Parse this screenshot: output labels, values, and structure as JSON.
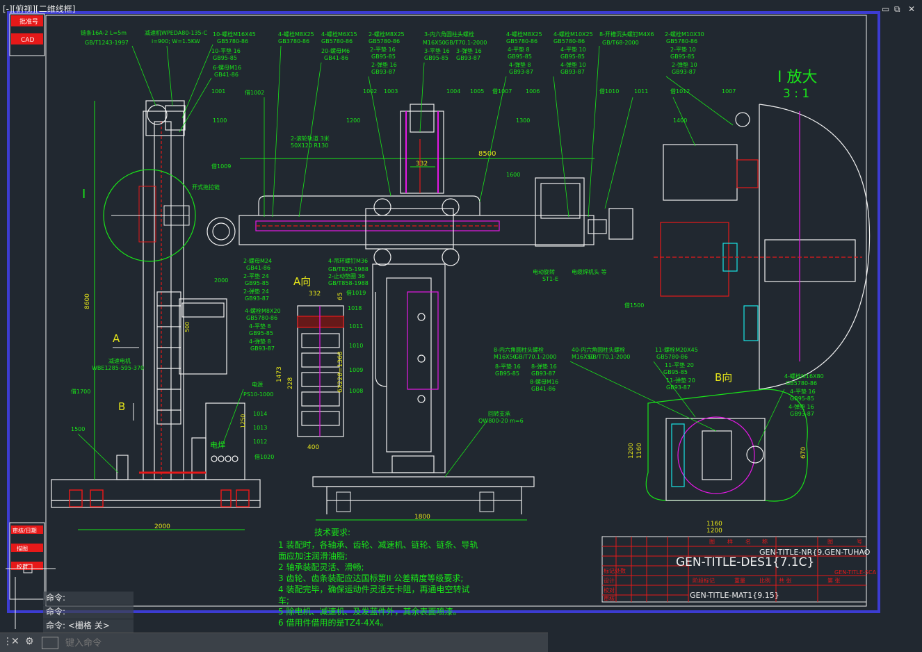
{
  "viewport_label": "[-][俯视][二维线框]",
  "window_controls": [
    "▭",
    "⧉",
    "✕"
  ],
  "side_panel_labels": [
    "批准号",
    "CAD"
  ],
  "side_panel_bottom_labels": [
    "审核/日期",
    "描图",
    "校对"
  ],
  "main_title": {
    "label": "I 放大",
    "scale": "3 : 1"
  },
  "view_labels": {
    "a_view": "A向",
    "b_view": "B向",
    "arrow_a": "A",
    "arrow_b": "B",
    "detail_i": "I"
  },
  "callouts_top": [
    "链条16A-2 L=5m",
    "GB/T1243-1997",
    "减速机WPEDA80-135-C",
    "i=900; W=1.5KW",
    "10-螺栓M16X45",
    "GB5780-86",
    "10-平垫 16",
    "GB95-85",
    "6-螺母M16",
    "GB41-86",
    "4-螺栓M8X25",
    "GB3780-86",
    "4-螺栓M6X15",
    "GB5780-86",
    "20-螺母M6",
    "GB41-86",
    "2-螺栓M8X25",
    "GB5780-86",
    "2-平垫 16",
    "GB95-85",
    "2-弹垫 16",
    "GB93-87",
    "3-内六角圆柱头螺栓",
    "M16X50",
    "GB/T70.1-2000",
    "3-平垫 16",
    "3-弹垫 16",
    "GB95-85",
    "GB93-87",
    "4-螺栓M8X25",
    "GB5780-86",
    "4-平垫 8",
    "GB95-85",
    "4-弹垫 8",
    "GB93-87",
    "4-螺栓M10X25",
    "GB5780-86",
    "4-平垫 10",
    "GB95-85",
    "4-弹垫 10",
    "GB93-87",
    "8-开槽沉头螺钉M4X6",
    "GB/T68-2000",
    "2-螺栓M10X30",
    "GB5780-86",
    "2-平垫 10",
    "GB95-85",
    "2-弹垫 10",
    "GB93-87"
  ],
  "part_numbers": [
    "1001",
    "1100",
    "借1002",
    "1002",
    "1003",
    "1004",
    "1005",
    "借1007",
    "1006",
    "借1010",
    "1011",
    "借1012",
    "1007",
    "1200",
    "1300",
    "1400",
    "1600",
    "借1009",
    "2000",
    "借1700",
    "1500",
    "1014",
    "1013",
    "1012",
    "借1020",
    "借1019",
    "1018",
    "1011",
    "1010",
    "1009",
    "1008",
    "借1500"
  ],
  "annotations": {
    "beam_length": "8500",
    "width_332": "332",
    "height_8600": "8600",
    "base_2000": "2000",
    "base_1800": "1800",
    "dim_1200": "1200",
    "dim_1160": "1160",
    "dim_670": "670",
    "dim_1473": "1473",
    "dim_228": "228",
    "dim_400": "400",
    "dim_332b": "332",
    "dim_65": "65",
    "dim_1250": "1250",
    "dim_500": "500",
    "dim_6x": "6X228=1368",
    "cable_drum": "开式拖拉链",
    "rail": "2-滚轮轨道 3米",
    "rail_size": "50X120 R130",
    "motor": "减速电机",
    "motor_code": "WBE1285-595-370",
    "power": "电源",
    "power_code": "PS10-1000",
    "welder": "电焊",
    "rotate": "电动旋转",
    "rotate_code": "ST1-E",
    "weld_head": "电缆焊机头 等",
    "flux": "回转支承",
    "flux_code": "QW800-20 m=6",
    "b_bolts_1": "8-内六角圆柱头螺栓",
    "b_bolts_2": "M16X50",
    "b_bolts_3": "GB/T70.1-2000",
    "b_bolts_4": "40-内六角圆柱头螺栓",
    "b_bolts_5": "M16X50",
    "b_bolts_6": "GB/T70.1-2000",
    "b_bolts_7": "11-螺栓M20X45",
    "b_bolts_8": "GB5780-86",
    "b_bolts_9": "11-平垫 20",
    "b_bolts_10": "GB95-85",
    "b_bolts_11": "11-弹垫 20",
    "b_bolts_12": "GB93-87",
    "b_bolts_13": "4-螺栓M16X80",
    "b_bolts_14": "GB5780-86",
    "b_bolts_15": "4-平垫 16",
    "b_bolts_16": "GB95-85",
    "b_bolts_17": "4-弹垫 16",
    "b_bolts_18": "GB93-87",
    "a_bolts_1": "2-螺母M24",
    "a_bolts_2": "GB41-86",
    "a_bolts_3": "2-平垫 24",
    "a_bolts_4": "GB95-85",
    "a_bolts_5": "2-弹垫 24",
    "a_bolts_6": "GB93-87",
    "a_bolts_7": "4-吊环螺钉M36",
    "a_bolts_8": "GB/T825-1988",
    "a_bolts_9": "2-止动垫圈 36",
    "a_bolts_10": "GB/T858-1988",
    "a_bolts_11": "4-螺栓M8X20",
    "a_bolts_12": "GB5780-86",
    "a_bolts_13": "4-平垫 8",
    "a_bolts_14": "GB95-85",
    "a_bolts_15": "4-弹垫 8",
    "a_bolts_16": "GB93-87",
    "b_bolts_19": "8-平垫 16",
    "b_bolts_20": "GB95-85",
    "b_bolts_21": "8-弹垫 16",
    "b_bolts_22": "GB93-87",
    "b_bolts_23": "8-螺母M16",
    "b_bolts_24": "GB41-86"
  },
  "tech_requirements": {
    "title": "技术要求:",
    "lines": [
      "1 装配时，各轴承、齿轮、减速机、链轮、链条、导轨",
      "面应加注润滑油脂;",
      "2 轴承装配灵活、滑畅;",
      "3 齿轮、齿条装配应达国标第II 公差精度等级要求;",
      "4 装配完毕，确保运动件灵活无卡阻，再通电空转试",
      "车;",
      "5 除电机、减速机、及发蓝件外，其余表面喷漆。",
      "6 借用件借用的是TZ4-4X4。"
    ]
  },
  "title_block": {
    "des": "GEN-TITLE-DES1{7.1C}",
    "nr": "GEN-TITLE-NR{9.GEN-TUHAO",
    "mat": "GEN-TITLE-MAT1{9.15}",
    "header_cells": [
      "图",
      "样",
      "名",
      "称",
      "图",
      "号"
    ],
    "rows": [
      "标记处数",
      "设计",
      "校对",
      "审核",
      "工艺",
      "批准"
    ],
    "small_text": [
      "阶段标记",
      "重量",
      "比例",
      "共 张",
      "第 张"
    ],
    "corner": "GEN-TITLE-SCA"
  },
  "command_history": [
    "命令:",
    "命令:",
    "命令:  <栅格 关>"
  ],
  "command_placeholder": "键入命令",
  "colors": {
    "background": "#212830",
    "green": "#19e619",
    "white": "#f0f0f0",
    "magenta": "#e619e6",
    "red": "#e61919",
    "cyan": "#19e6e6",
    "yellow": "#e6e619",
    "frame_blue": "#3c3cd2"
  }
}
